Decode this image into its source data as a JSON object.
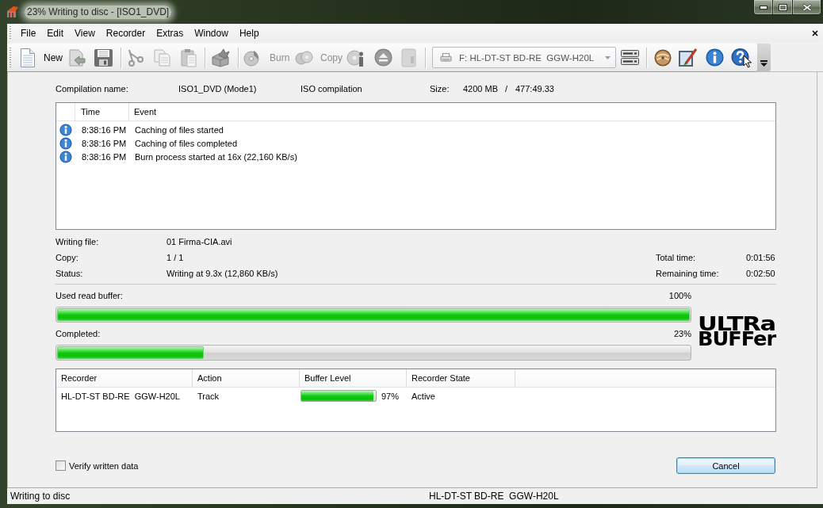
{
  "window": {
    "title": "23% Writing to disc - [ISO1_DVD]"
  },
  "menu_bar": {
    "items": [
      "File",
      "Edit",
      "View",
      "Recorder",
      "Extras",
      "Window",
      "Help"
    ]
  },
  "toolbar": {
    "new_button": {
      "label": "New",
      "disabled": false
    },
    "burn_button": {
      "label": "Burn",
      "disabled": true
    },
    "copy_button": {
      "label": "Copy",
      "disabled": true
    },
    "drive_select": {
      "value": "F: HL-DT-ST BD-RE  GGW-H20L"
    }
  },
  "compilation": {
    "name_label": "Compilation name:",
    "name": "ISO1_DVD (Mode1)",
    "type": "ISO compilation",
    "size_label": "Size:",
    "size": "4200 MB",
    "separator": "/",
    "duration": "477:49.33"
  },
  "event_log": {
    "columns": [
      "Time",
      "Event"
    ],
    "rows": [
      {
        "kind": "info",
        "time": "8:38:16 PM",
        "event": "Caching of files started"
      },
      {
        "kind": "info",
        "time": "8:38:16 PM",
        "event": "Caching of files completed"
      },
      {
        "kind": "info",
        "time": "8:38:16 PM",
        "event": "Burn process started at 16x (22,160 KB/s)"
      }
    ]
  },
  "details": {
    "fields": [
      {
        "label": "Writing file:",
        "value": "01 Firma-CIA.avi"
      },
      {
        "label": "Copy:",
        "value": "1 / 1"
      },
      {
        "label": "Status:",
        "value": "Writing at 9.3x (12,860 KB/s)"
      }
    ],
    "times": [
      {
        "label": "Total time:",
        "value": "0:01:56"
      },
      {
        "label": "Remaining time:",
        "value": "0:02:50"
      }
    ]
  },
  "progress": [
    {
      "label": "Used read buffer:",
      "reading": "100%",
      "level": 1
    },
    {
      "label": "Completed:",
      "reading": "23%",
      "level": 0.23
    }
  ],
  "logo": {
    "line_1": "ULTRa",
    "line_2": "BUFFer"
  },
  "recorders": {
    "columns": [
      "Recorder",
      "Action",
      "Buffer Level",
      "Recorder State"
    ],
    "rows": [
      {
        "recorder": "HL-DT-ST BD-RE  GGW-H20L",
        "action": "Track",
        "buffer": {
          "level": 0.97,
          "reading": "97%"
        },
        "state": "Active"
      }
    ]
  },
  "verify": {
    "label": "Verify written data",
    "checked": false
  },
  "cancel_button": {
    "label": "Cancel",
    "focused": true
  },
  "status_bar": {
    "message": "Writing to disc",
    "drive": "HL-DT-ST BD-RE  GGW-H20L"
  }
}
